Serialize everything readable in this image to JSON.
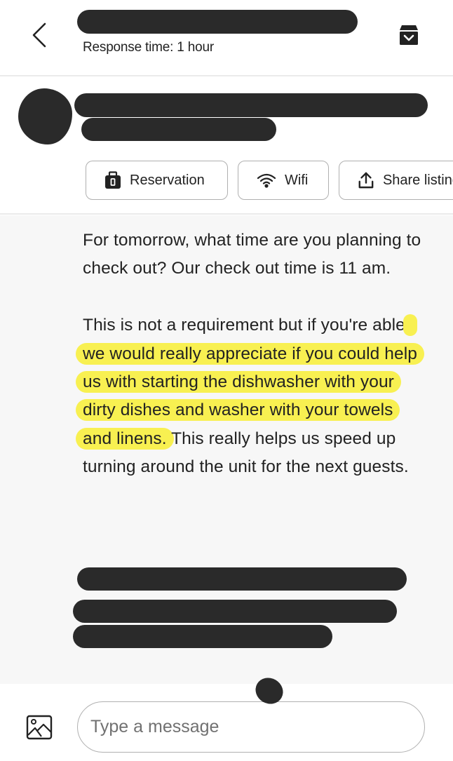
{
  "header": {
    "title": "[redacted]",
    "subtitle": "Response time: 1 hour",
    "back_icon": "chevron-left-icon",
    "archive_icon": "archive-icon"
  },
  "listing_info": {
    "name": "[redacted]",
    "details": "[redacted]",
    "chips": [
      {
        "label": "Reservation",
        "icon": "briefcase-icon"
      },
      {
        "label": "Wifi",
        "icon": "wifi-icon"
      },
      {
        "label": "Share listing",
        "icon": "share-icon"
      }
    ]
  },
  "thread": {
    "message": {
      "paragraph1": "For tomorrow, what time are you planning to check out? Our check out time is 11 am.",
      "paragraph2_before": "This is not a requirement but if you're able,",
      "paragraph2_highlight": " we would really appreciate if you could help us with starting the dishwasher with your dirty dishes and washer with your towels and linens.",
      "paragraph2_after": " This really helps us speed up turning around the unit for the next guests.",
      "highlight_color": "#f8f051"
    },
    "redacted_paragraph": "[redacted]"
  },
  "composer": {
    "placeholder": "Type a message",
    "value": "",
    "photo_icon": "image-icon"
  }
}
